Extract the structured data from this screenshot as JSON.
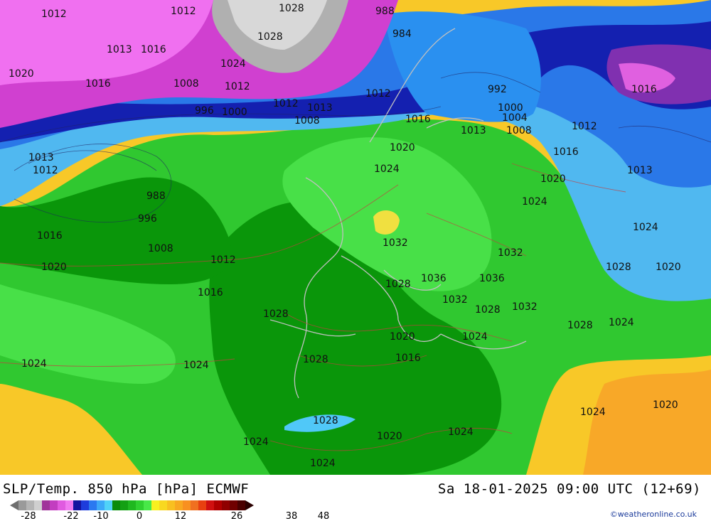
{
  "title": "SLP/Temp. 850 hPa [hPa] ECMWF",
  "datetime": "Sa 18-01-2025 09:00 UTC (12+69)",
  "credit": "©weatheronline.co.uk",
  "legend": {
    "tick_labels": [
      "-28",
      "-22",
      "-10",
      "0",
      "12",
      "26",
      "38",
      "48"
    ],
    "colors": [
      "#9a9a9a",
      "#b4b4b4",
      "#cfcfcf",
      "#a0339a",
      "#c23ec0",
      "#e05ae0",
      "#f07af0",
      "#1414a0",
      "#1e3cdc",
      "#2a78f0",
      "#3ca8f8",
      "#50d2f8",
      "#0a8c0a",
      "#14a014",
      "#20b820",
      "#30d030",
      "#48e848",
      "#f8f020",
      "#f8d820",
      "#f8c020",
      "#f8a820",
      "#f89020",
      "#f07020",
      "#e84010",
      "#d01010",
      "#b00000",
      "#900000",
      "#700000",
      "#4a0000"
    ]
  },
  "isobars": [
    {
      "text": "1012",
      "kind": "slp"
    },
    {
      "text": "1012",
      "kind": "slp"
    },
    {
      "text": "1028",
      "kind": "slp"
    },
    {
      "text": "988",
      "kind": "slp"
    },
    {
      "text": "1028",
      "kind": "slp"
    },
    {
      "text": "984",
      "kind": "slp"
    },
    {
      "text": "1013",
      "kind": "slp"
    },
    {
      "text": "1016",
      "kind": "slp"
    },
    {
      "text": "1024",
      "kind": "slp"
    },
    {
      "text": "1020",
      "kind": "slp"
    },
    {
      "text": "1016",
      "kind": "slp"
    },
    {
      "text": "1008",
      "kind": "slp"
    },
    {
      "text": "1012",
      "kind": "slp"
    },
    {
      "text": "1012",
      "kind": "slp"
    },
    {
      "text": "992",
      "kind": "slp"
    },
    {
      "text": "1016",
      "kind": "slp"
    },
    {
      "text": "996",
      "kind": "slp"
    },
    {
      "text": "1000",
      "kind": "slp"
    },
    {
      "text": "1013",
      "kind": "slp"
    },
    {
      "text": "1008",
      "kind": "slp"
    },
    {
      "text": "1016",
      "kind": "slp"
    },
    {
      "text": "1000",
      "kind": "slp"
    },
    {
      "text": "1004",
      "kind": "slp"
    },
    {
      "text": "1012",
      "kind": "slp"
    },
    {
      "text": "1012",
      "kind": "slp"
    },
    {
      "text": "1013",
      "kind": "slp"
    },
    {
      "text": "1008",
      "kind": "slp"
    },
    {
      "text": "1013",
      "kind": "slp"
    },
    {
      "text": "1012",
      "kind": "slp"
    },
    {
      "text": "1020",
      "kind": "slp"
    },
    {
      "text": "1016",
      "kind": "slp"
    },
    {
      "text": "1024",
      "kind": "slp"
    },
    {
      "text": "1013",
      "kind": "slp"
    },
    {
      "text": "1020",
      "kind": "slp"
    },
    {
      "text": "988",
      "kind": "slp"
    },
    {
      "text": "1024",
      "kind": "slp"
    },
    {
      "text": "996",
      "kind": "slp"
    },
    {
      "text": "1016",
      "kind": "slp"
    },
    {
      "text": "1024",
      "kind": "slp"
    },
    {
      "text": "1008",
      "kind": "slp"
    },
    {
      "text": "1032",
      "kind": "slp"
    },
    {
      "text": "1012",
      "kind": "slp"
    },
    {
      "text": "1020",
      "kind": "slp"
    },
    {
      "text": "1032",
      "kind": "slp"
    },
    {
      "text": "1028",
      "kind": "slp"
    },
    {
      "text": "1020",
      "kind": "slp"
    },
    {
      "text": "1016",
      "kind": "slp"
    },
    {
      "text": "1036",
      "kind": "slp"
    },
    {
      "text": "1036",
      "kind": "slp"
    },
    {
      "text": "1028",
      "kind": "slp"
    },
    {
      "text": "1032",
      "kind": "slp"
    },
    {
      "text": "1028",
      "kind": "slp"
    },
    {
      "text": "1032",
      "kind": "slp"
    },
    {
      "text": "1028",
      "kind": "slp"
    },
    {
      "text": "1024",
      "kind": "slp"
    },
    {
      "text": "1028",
      "kind": "slp"
    },
    {
      "text": "1020",
      "kind": "slp"
    },
    {
      "text": "1024",
      "kind": "slp"
    },
    {
      "text": "1024",
      "kind": "slp"
    },
    {
      "text": "1028",
      "kind": "slp"
    },
    {
      "text": "1024",
      "kind": "slp"
    },
    {
      "text": "1016",
      "kind": "slp"
    },
    {
      "text": "1024",
      "kind": "slp"
    },
    {
      "text": "1020",
      "kind": "slp"
    },
    {
      "text": "1028",
      "kind": "slp"
    },
    {
      "text": "1024",
      "kind": "slp"
    },
    {
      "text": "1020",
      "kind": "slp"
    },
    {
      "text": "1024",
      "kind": "slp"
    },
    {
      "text": "1024",
      "kind": "slp"
    }
  ]
}
